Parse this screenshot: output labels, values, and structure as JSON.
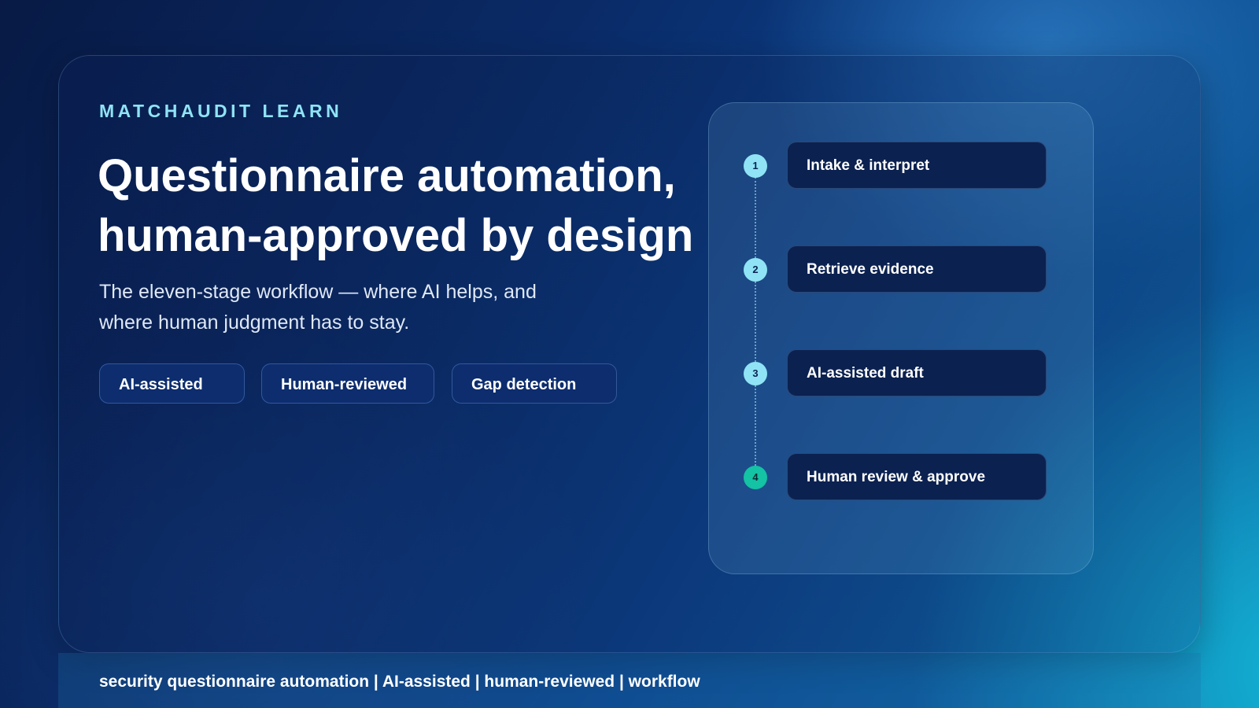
{
  "hero": {
    "eyebrow": "MATCHAUDIT LEARN",
    "title": "Questionnaire automation, human-approved by design",
    "subtitle": "The eleven-stage workflow — where AI helps, and where human judgment has to stay."
  },
  "tags": [
    "AI-assisted",
    "Human-reviewed",
    "Gap detection"
  ],
  "workflow": {
    "steps": [
      {
        "number": "1",
        "label": "Intake & interpret"
      },
      {
        "number": "2",
        "label": "Retrieve evidence"
      },
      {
        "number": "3",
        "label": "AI-assisted draft"
      },
      {
        "number": "4",
        "label": "Human review & approve"
      }
    ]
  },
  "footer": {
    "keywords": "security questionnaire automation | AI-assisted | human-reviewed | workflow"
  },
  "colors": {
    "eyebrow": "#8fe3f5",
    "step_badge": "#8fe3f5",
    "final_step_badge": "#14c2a4",
    "step_box": "#0b2150",
    "tag_bg": "#0d2d6e"
  }
}
